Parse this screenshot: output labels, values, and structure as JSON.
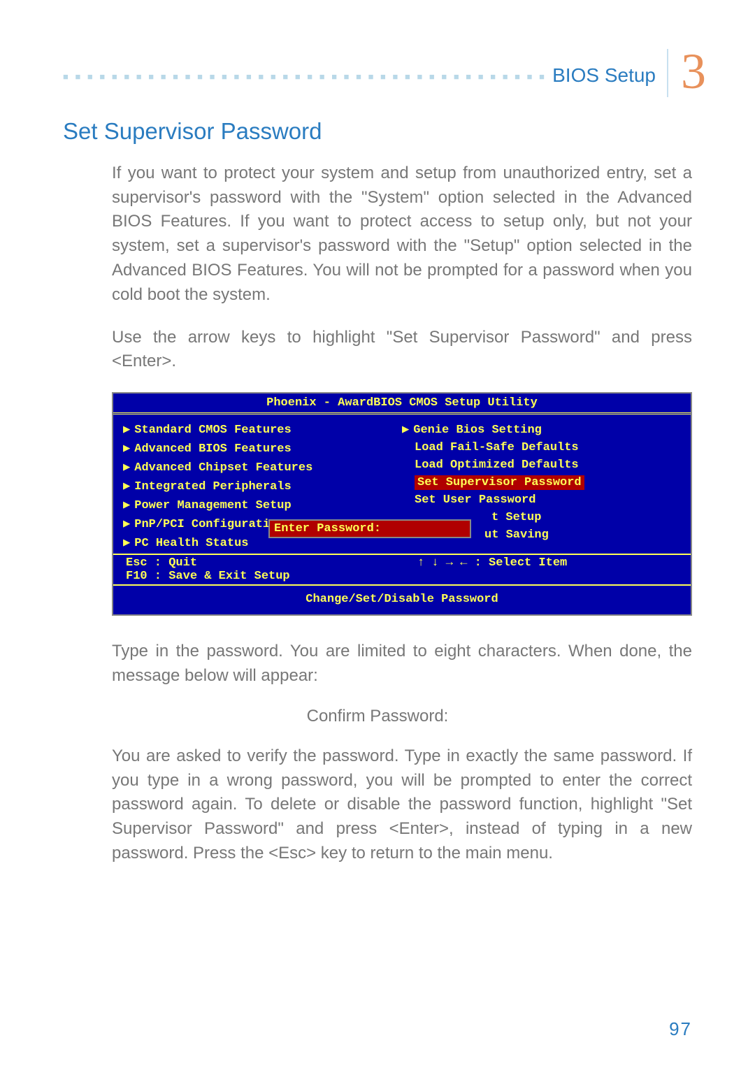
{
  "header": {
    "breadcrumb": "BIOS Setup",
    "chapter": "3"
  },
  "section_title": "Set Supervisor Password",
  "para1": "If you want to protect your system and setup from unauthorized entry, set a supervisor's password with the \"System\" option selected in the Advanced BIOS Features. If you want to protect access to setup only, but not your system, set a supervisor's password with the \"Setup\" option selected in the Advanced BIOS Features. You will not be prompted for a password when you cold boot the system.",
  "para2": "Use the arrow keys to highlight \"Set Supervisor Password\" and press <Enter>.",
  "bios": {
    "title": "Phoenix - AwardBIOS CMOS Setup Utility",
    "left_items": [
      "Standard CMOS Features",
      "Advanced BIOS Features",
      "Advanced Chipset Features",
      "Integrated Peripherals",
      "Power Management Setup",
      "PnP/PCI Configurati",
      "PC Health Status"
    ],
    "right_items": [
      "Genie Bios Setting",
      "Load Fail-Safe Defaults",
      "Load Optimized Defaults",
      "Set Supervisor Password",
      "Set User Password",
      "t Setup",
      "ut Saving"
    ],
    "popup": "Enter Password:",
    "key_esc": "Esc : Quit",
    "key_f10": "F10 : Save & Exit Setup",
    "key_arrows": "↑ ↓ → ←   : Select Item",
    "footer": "Change/Set/Disable Password"
  },
  "para3": "Type in the password. You are limited to eight characters. When done, the message below will appear:",
  "confirm": "Confirm Password:",
  "para4": "You are asked to verify the password. Type in exactly the same password. If you type in a wrong password, you will be prompted to enter the correct password again. To delete or disable the password function, highlight \"Set Supervisor Password\" and press <Enter>, instead of typing in a new password. Press the <Esc> key to return to the main menu.",
  "page_number": "97"
}
